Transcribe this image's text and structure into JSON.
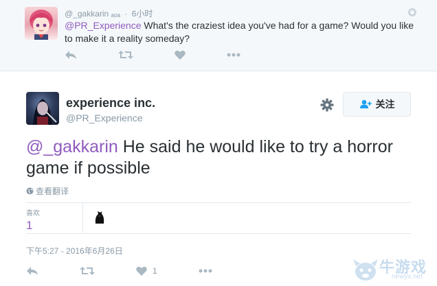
{
  "parent_tweet": {
    "username": "@_gakkarin",
    "username_suffix": "ₐₒₐ",
    "separator": "·",
    "time": "6小时",
    "mention": "@PR_Experience",
    "text": " What's the craziest idea you've had for a game? Would you like to make it a reality someday?",
    "actions": [
      "reply-icon",
      "retweet-icon",
      "heart-icon",
      "more-icon"
    ]
  },
  "main_tweet": {
    "display_name": "experience inc.",
    "screen_name": "@PR_Experience",
    "follow_label": "关注",
    "mention": "@_gakkarin",
    "text": " He said he would like to try a horror game if possible",
    "translate_label": "查看翻译",
    "likes_label": "喜欢",
    "likes_count": "1",
    "timestamp": "下午5:27 - 2016年6月26日",
    "action_like_count": "1"
  },
  "watermark": {
    "text": "牛游戏",
    "url": "newyx.net"
  },
  "colors": {
    "mention": "#8f5bbf",
    "muted": "#8899a6",
    "icon": "#aab8c2",
    "parent_bg": "#f5f8fa",
    "watermark": "#c8dcef"
  }
}
